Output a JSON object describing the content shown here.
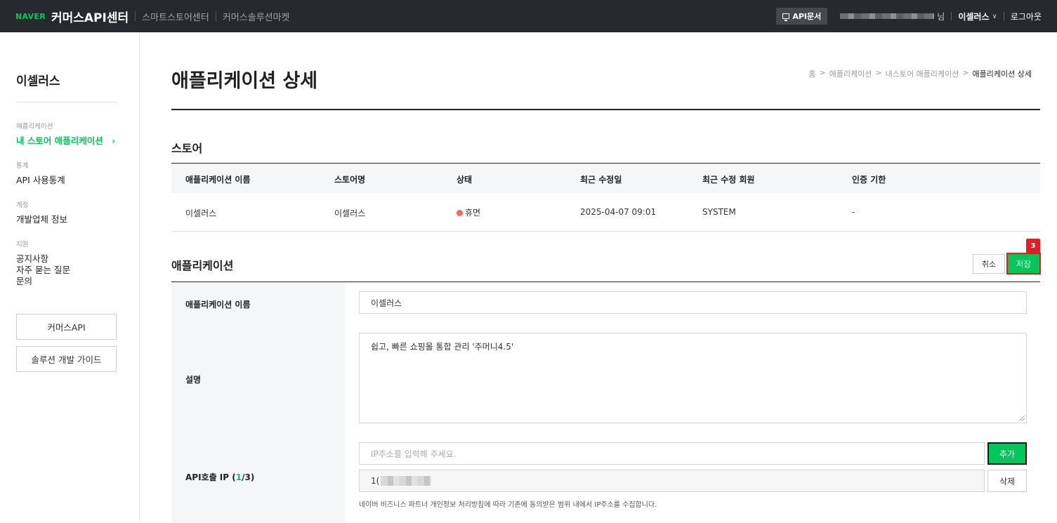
{
  "header": {
    "brand": "NAVER",
    "title": "커머스API센터",
    "links": [
      "스마트스토어센터",
      "커머스솔루션마켓"
    ],
    "api_doc": "API문서",
    "user_suffix": "님",
    "user_name": "이셀러스",
    "logout": "로그아웃"
  },
  "sidebar": {
    "title": "이셀러스",
    "groups": [
      {
        "label": "애플리케이션",
        "items": [
          "내 스토어 애플리케이션"
        ]
      },
      {
        "label": "통계",
        "items": [
          "API 사용통계"
        ]
      },
      {
        "label": "계정",
        "items": [
          "개발업체 정보"
        ]
      },
      {
        "label": "지원",
        "items": [
          "공지사항",
          "자주 묻는 질문",
          "문의"
        ]
      }
    ],
    "active_arrow": "›",
    "buttons": [
      "커머스API",
      "솔루션 개발 가이드"
    ]
  },
  "page": {
    "title": "애플리케이션 상세",
    "breadcrumb": [
      "홈",
      "애플리케이션",
      "내스토어 애플리케이션",
      "애플리케이션 상세"
    ],
    "breadcrumb_sep": ">"
  },
  "store_section": {
    "title": "스토어",
    "columns": [
      "애플리케이션 이름",
      "스토어명",
      "상태",
      "최근 수정일",
      "최근 수정 회원",
      "인증 기한"
    ],
    "row": {
      "app_name": "이셀러스",
      "store_name": "이셀러스",
      "status": "휴면",
      "status_color": "#f36a5a",
      "modified_date": "2025-04-07 09:01",
      "modified_by": "SYSTEM",
      "auth_expiry": "-"
    }
  },
  "app_section": {
    "title": "애플리케이션",
    "cancel_label": "취소",
    "save_label": "저장",
    "badge": "3",
    "name_label": "애플리케이션 이름",
    "name_value": "이셀러스",
    "desc_label": "설명",
    "desc_value": "쉽고, 빠른 쇼핑몰 통합 관리 '주머니4.5'",
    "ip_label_prefix": "API호출 IP (",
    "ip_count": "1",
    "ip_label_suffix": "/3)",
    "ip_placeholder": "IP주소를 입력해 주세요.",
    "add_label": "추가",
    "ip_value_prefix": "1(",
    "delete_label": "삭제",
    "helper": "네이버 비즈니스 파트너 개인정보 처리방침에 따라 기존에 동의받은 범위 내에서 IP주소를 수집합니다."
  },
  "colors": {
    "accent": "#03c75a",
    "topbar": "#26292d",
    "highlight": "#e02020"
  }
}
